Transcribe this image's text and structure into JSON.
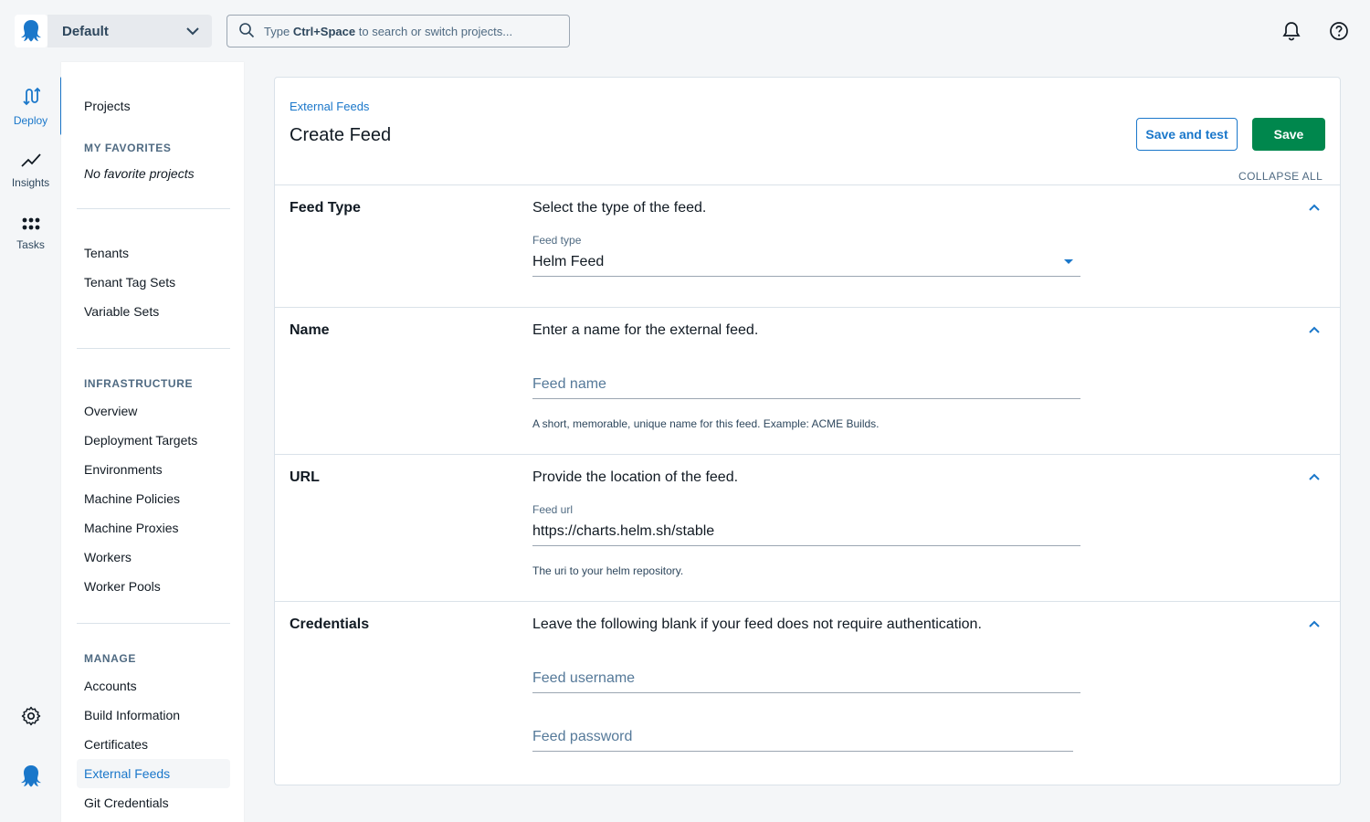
{
  "header": {
    "space_name": "Default",
    "search_prefix": "Type",
    "search_shortcut": "Ctrl+Space",
    "search_suffix": "to search or switch projects..."
  },
  "rail": {
    "items": [
      {
        "label": "Deploy",
        "icon": "deploy-icon"
      },
      {
        "label": "Insights",
        "icon": "insights-icon"
      },
      {
        "label": "Tasks",
        "icon": "tasks-icon"
      }
    ]
  },
  "sidebar": {
    "projects": "Projects",
    "favorites_heading": "MY FAVORITES",
    "favorites_empty": "No favorite projects",
    "tenants": [
      "Tenants",
      "Tenant Tag Sets",
      "Variable Sets"
    ],
    "infrastructure_heading": "INFRASTRUCTURE",
    "infrastructure": [
      "Overview",
      "Deployment Targets",
      "Environments",
      "Machine Policies",
      "Machine Proxies",
      "Workers",
      "Worker Pools"
    ],
    "manage_heading": "MANAGE",
    "manage": [
      "Accounts",
      "Build Information",
      "Certificates",
      "External Feeds",
      "Git Credentials"
    ],
    "active_item": "External Feeds"
  },
  "main": {
    "breadcrumb": "External Feeds",
    "title": "Create Feed",
    "save_and_test_label": "Save and test",
    "save_label": "Save",
    "collapse_all": "COLLAPSE ALL",
    "sections": {
      "feed_type": {
        "title": "Feed Type",
        "description": "Select the type of the feed.",
        "field_label": "Feed type",
        "value": "Helm Feed"
      },
      "name": {
        "title": "Name",
        "description": "Enter a name for the external feed.",
        "placeholder": "Feed name",
        "help": "A short, memorable, unique name for this feed. Example: ACME Builds."
      },
      "url": {
        "title": "URL",
        "description": "Provide the location of the feed.",
        "field_label": "Feed url",
        "value": "https://charts.helm.sh/stable",
        "help": "The uri to your helm repository."
      },
      "credentials": {
        "title": "Credentials",
        "description": "Leave the following blank if your feed does not require authentication.",
        "username_placeholder": "Feed username",
        "password_placeholder": "Feed password"
      }
    }
  },
  "colors": {
    "accent": "#1a77ca",
    "primary_button": "#00874d",
    "text": "#111a23",
    "muted": "#4f6a82"
  }
}
